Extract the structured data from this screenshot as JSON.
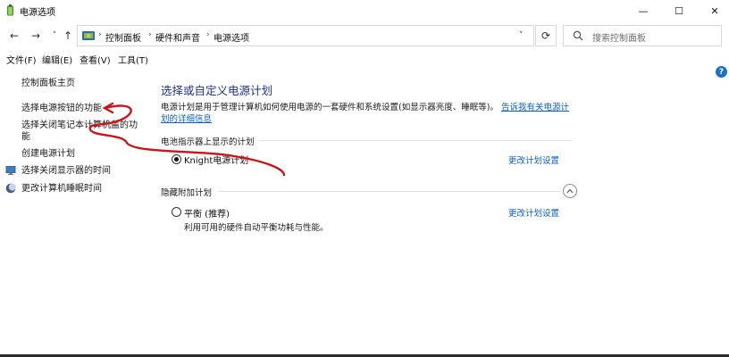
{
  "window": {
    "title": "电源选项",
    "minimize_glyph": "—",
    "maximize_glyph": "☐",
    "close_glyph": "✕"
  },
  "nav": {
    "back": "←",
    "forward": "→",
    "recent": "˅",
    "up": "↑",
    "breadcrumbs": [
      "控制面板",
      "硬件和声音",
      "电源选项"
    ],
    "separator": "›",
    "dropdown": "˅",
    "refresh": "⟳",
    "search_placeholder": "搜索控制面板"
  },
  "menu": [
    "文件(F)",
    "编辑(E)",
    "查看(V)",
    "工具(T)"
  ],
  "help": "?",
  "sidebar": {
    "home": "控制面板主页",
    "items": [
      {
        "label": "选择电源按钮的功能",
        "icon": "none"
      },
      {
        "label_line1": "选择关闭笔记本计算机盖的功",
        "label_line2": "能",
        "icon": "none"
      },
      {
        "label": "创建电源计划",
        "icon": "none"
      },
      {
        "label": "选择关闭显示器的时间",
        "icon": "monitor-icon"
      },
      {
        "label": "更改计算机睡眠时间",
        "icon": "moon-icon"
      }
    ]
  },
  "main": {
    "title": "选择或自定义电源计划",
    "description": "电源计划是用于管理计算机如何使用电源的一套硬件和系统设置(如显示器亮度、睡眠等)。",
    "description_link": "告诉我有关电源计",
    "description_link_line2": "划的详细信息",
    "battery_section": "电池指示器上显示的计划",
    "hidden_section": "隐藏附加计划",
    "plans": [
      {
        "name": "Knight电源计划",
        "selected": true,
        "link": "更改计划设置",
        "desc": ""
      },
      {
        "name": "平衡 (推荐)",
        "selected": false,
        "link": "更改计划设置",
        "desc": "利用可用的硬件自动平衡功耗与性能。"
      }
    ]
  },
  "colors": {
    "title_blue": "#1e3287",
    "link_blue": "#0b5fc2",
    "annotation_red": "#c8161d"
  }
}
